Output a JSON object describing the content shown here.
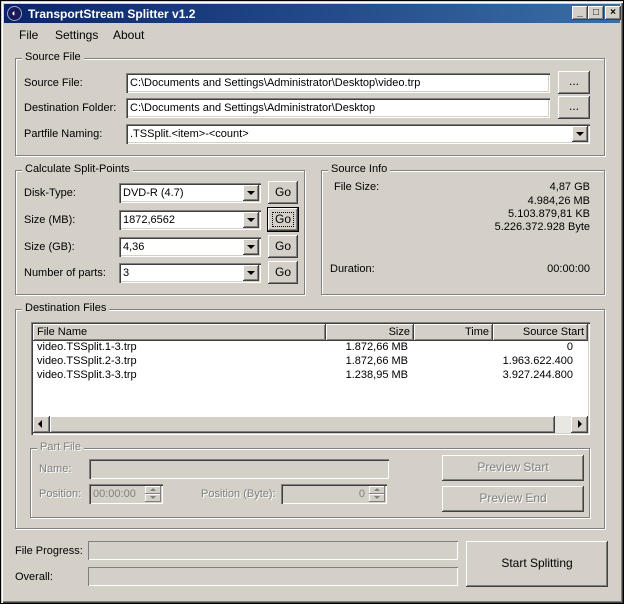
{
  "window": {
    "title": "TransportStream Splitter v1.2",
    "icon": "app-icon",
    "controls": {
      "minimize": "_",
      "maximize": "□",
      "close": "×"
    }
  },
  "menu": {
    "items": [
      "File",
      "Settings",
      "About"
    ]
  },
  "source_file_group": {
    "title": "Source File",
    "source_file_label": "Source File:",
    "source_file_value": "C:\\Documents and Settings\\Administrator\\Desktop\\video.trp",
    "dest_folder_label": "Destination Folder:",
    "dest_folder_value": "C:\\Documents and Settings\\Administrator\\Desktop",
    "partfile_label": "Partfile Naming:",
    "partfile_value": ".TSSplit.<item>-<count>",
    "browse_label": "..."
  },
  "split_points_group": {
    "title": "Calculate Split-Points",
    "disk_type_label": "Disk-Type:",
    "disk_type_value": "DVD-R (4.7)",
    "size_mb_label": "Size (MB):",
    "size_mb_value": "1872,6562",
    "size_gb_label": "Size (GB):",
    "size_gb_value": "4,36",
    "num_parts_label": "Number of parts:",
    "num_parts_value": "3",
    "go_label": "Go"
  },
  "source_info_group": {
    "title": "Source Info",
    "file_size_label": "File Size:",
    "file_size_gb": "4,87 GB",
    "file_size_mb": "4.984,26 MB",
    "file_size_kb": "5.103.879,81 KB",
    "file_size_byte": "5.226.372.928 Byte",
    "duration_label": "Duration:",
    "duration_value": "00:00:00"
  },
  "destination_files_group": {
    "title": "Destination Files",
    "columns": [
      "File Name",
      "Size",
      "Time",
      "Source Start"
    ],
    "rows": [
      {
        "name": "video.TSSplit.1-3.trp",
        "size": "1.872,66 MB",
        "time": "",
        "start": "0"
      },
      {
        "name": "video.TSSplit.2-3.trp",
        "size": "1.872,66 MB",
        "time": "",
        "start": "1.963.622.400"
      },
      {
        "name": "video.TSSplit.3-3.trp",
        "size": "1.238,95 MB",
        "time": "",
        "start": "3.927.244.800"
      }
    ]
  },
  "part_file_group": {
    "title": "Part File",
    "name_label": "Name:",
    "position_label": "Position:",
    "position_value": "00:00:00",
    "position_byte_label": "Position (Byte):",
    "position_byte_value": "0",
    "preview_start_label": "Preview Start",
    "preview_end_label": "Preview End"
  },
  "progress": {
    "file_progress_label": "File Progress:",
    "overall_label": "Overall:",
    "file_progress_fraction": 0,
    "overall_fraction": 0,
    "start_button_label": "Start Splitting"
  }
}
